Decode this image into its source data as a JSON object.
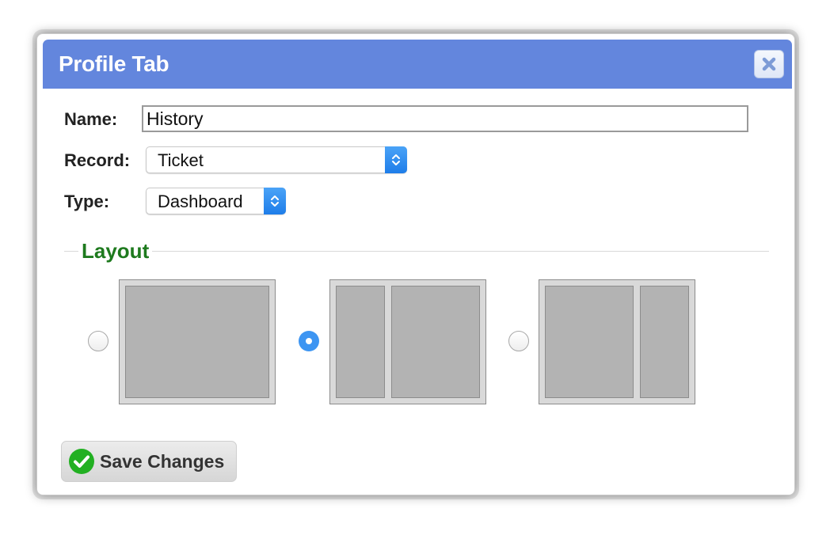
{
  "dialog": {
    "title": "Profile Tab",
    "close_icon": "close-icon"
  },
  "form": {
    "name_label": "Name:",
    "name_value": "History",
    "record_label": "Record:",
    "record_value": "Ticket",
    "type_label": "Type:",
    "type_value": "Dashboard"
  },
  "layout": {
    "legend": "Layout",
    "options": [
      {
        "id": "single-column",
        "selected": false
      },
      {
        "id": "narrow-wide",
        "selected": true
      },
      {
        "id": "wide-narrow",
        "selected": false
      }
    ]
  },
  "actions": {
    "save_label": "Save Changes",
    "save_icon": "check-circle-icon"
  },
  "colors": {
    "titlebar": "#6386dd",
    "legend": "#1e7a1e",
    "radio_selected": "#3d95f2",
    "save_check": "#22b022"
  }
}
